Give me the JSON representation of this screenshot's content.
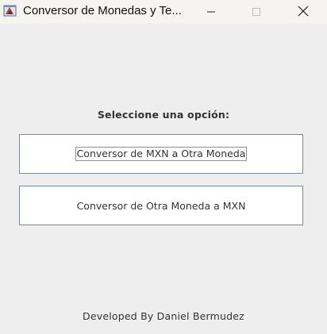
{
  "window": {
    "title": "Conversor de Monedas y Te...",
    "controls": {
      "minimize_icon": "minimize-icon",
      "maximize_icon": "maximize-icon",
      "close_icon": "close-icon"
    }
  },
  "main": {
    "prompt": "Seleccione una opción:",
    "options": [
      {
        "label": "Conversor de MXN a Otra Moneda",
        "focused": true
      },
      {
        "label": "Conversor de Otra Moneda a MXN",
        "focused": false
      }
    ],
    "footer": "Developed By Daniel Bermudez"
  },
  "colors": {
    "background": "#eeeeee",
    "titlebar": "#f6f4f1",
    "button_bg": "#ffffff",
    "button_border": "#7a8a99",
    "text": "#333333"
  }
}
